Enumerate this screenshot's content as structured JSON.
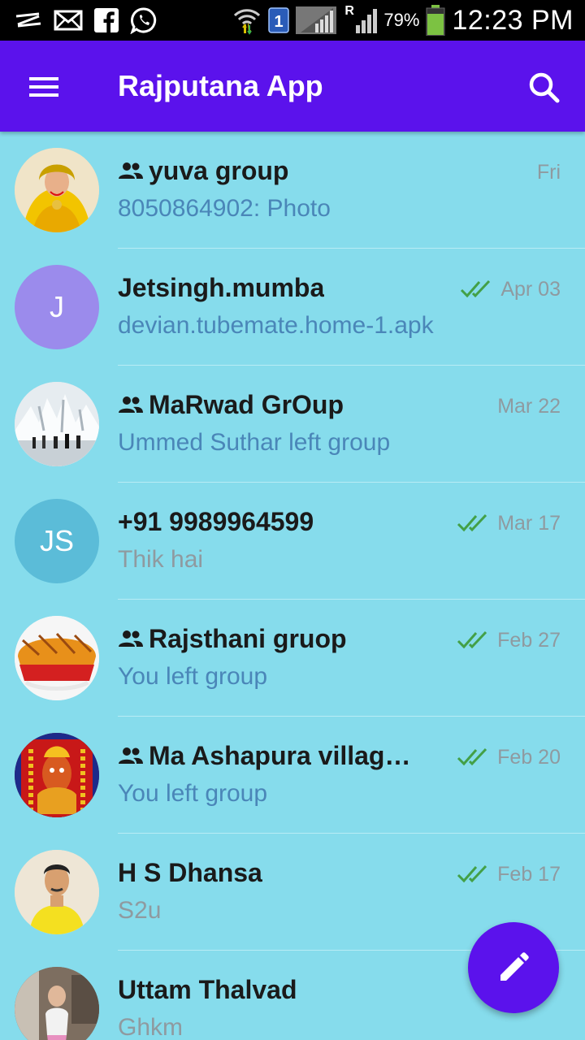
{
  "status_bar": {
    "icons": [
      "z-icon",
      "mail-icon",
      "facebook-icon",
      "whatsapp-icon",
      "wifi-icon",
      "sim1-icon",
      "signal-icon",
      "roaming-signal-icon",
      "battery-icon"
    ],
    "roaming_label": "R",
    "sim_label": "1",
    "battery": "79%",
    "time": "12:23 PM"
  },
  "appbar": {
    "title": "Rajputana App",
    "menu_icon": "hamburger-icon",
    "search_icon": "search-icon"
  },
  "colors": {
    "primary": "#5b12ec",
    "background": "#86dcec",
    "tick_green": "#43a047"
  },
  "chats": [
    {
      "name": "yuva group",
      "is_group": true,
      "time": "Fri",
      "ticks": false,
      "message": "8050864902: Photo",
      "message_style": "blue",
      "avatar_type": "photo"
    },
    {
      "name": "Jetsingh.mumba",
      "is_group": false,
      "time": "Apr 03",
      "ticks": true,
      "message": "devian.tubemate.home-1.apk",
      "message_style": "blue",
      "avatar_type": "initials",
      "initials": "J",
      "avatar_color": "#9b8bec"
    },
    {
      "name": "MaRwad GrOup",
      "is_group": true,
      "time": "Mar 22",
      "ticks": false,
      "message": "Ummed Suthar left group",
      "message_style": "blue",
      "avatar_type": "photo"
    },
    {
      "name": "+91 9989964599",
      "is_group": false,
      "time": "Mar 17",
      "ticks": true,
      "message": "Thik hai",
      "message_style": "gray",
      "avatar_type": "initials",
      "initials": "JS",
      "avatar_color": "#5bbcd8"
    },
    {
      "name": "Rajsthani gruop",
      "is_group": true,
      "time": "Feb 27",
      "ticks": true,
      "message": "You left group",
      "message_style": "blue",
      "avatar_type": "photo"
    },
    {
      "name": "Ma Ashapura villag…",
      "is_group": true,
      "time": "Feb 20",
      "ticks": true,
      "message": "You left group",
      "message_style": "blue",
      "avatar_type": "photo"
    },
    {
      "name": "H S Dhansa",
      "is_group": false,
      "time": "Feb 17",
      "ticks": true,
      "message": "S2u",
      "message_style": "gray",
      "avatar_type": "photo"
    },
    {
      "name": "Uttam Thalvad",
      "is_group": false,
      "time": "",
      "ticks": true,
      "message": "Ghkm",
      "message_style": "gray",
      "avatar_type": "photo"
    }
  ],
  "fab": {
    "icon": "pencil-icon"
  }
}
